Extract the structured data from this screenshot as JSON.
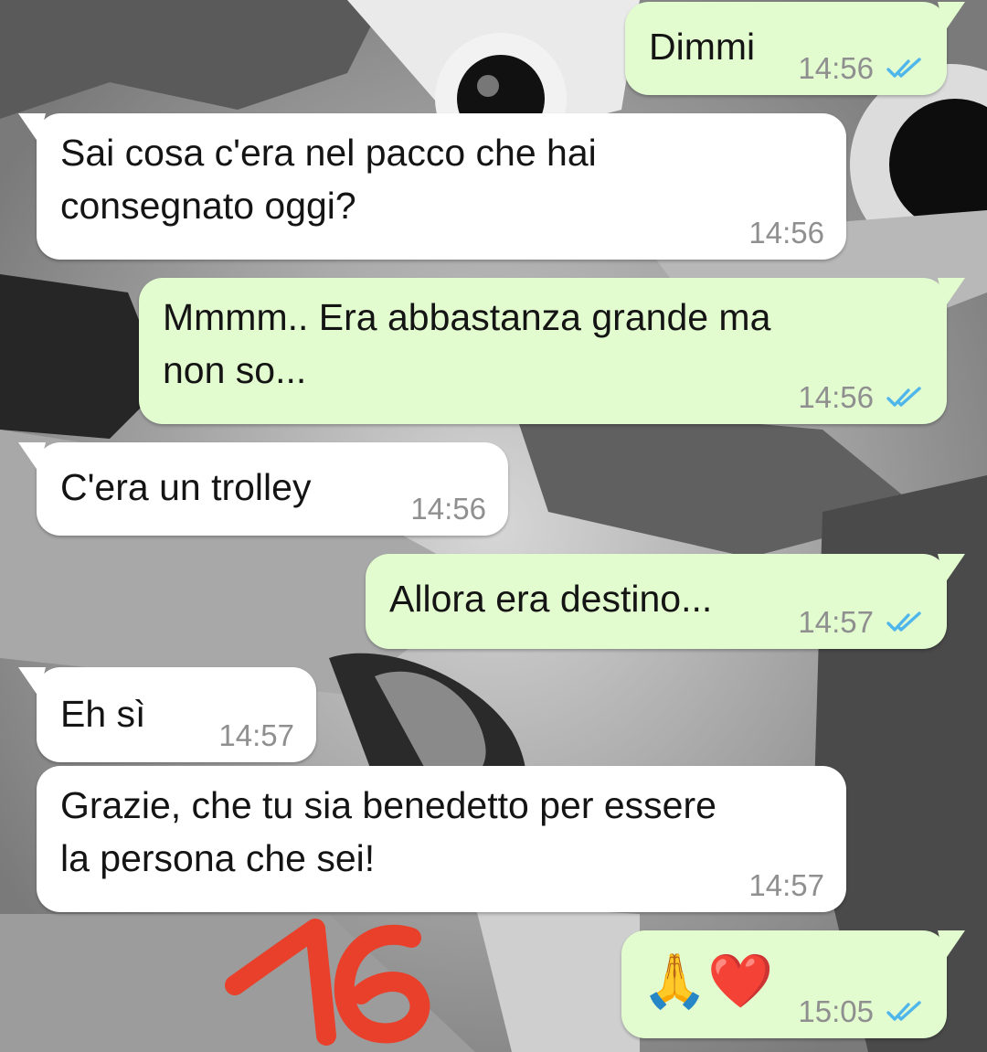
{
  "chat": {
    "messages": [
      {
        "direction": "out",
        "text": "Dimmi",
        "time": "14:56",
        "status_icon": "double-check-read-icon"
      },
      {
        "direction": "in",
        "text": "Sai cosa c'era nel pacco che hai\nconsegnato oggi?",
        "time": "14:56"
      },
      {
        "direction": "out",
        "text": "Mmmm.. Era abbastanza grande ma\nnon so...",
        "time": "14:56",
        "status_icon": "double-check-read-icon"
      },
      {
        "direction": "in",
        "text": "C'era un trolley",
        "time": "14:56"
      },
      {
        "direction": "out",
        "text": "Allora era destino...",
        "time": "14:57",
        "status_icon": "double-check-read-icon"
      },
      {
        "direction": "in",
        "text": "Eh sì",
        "time": "14:57"
      },
      {
        "direction": "in",
        "text": "Grazie, che tu sia benedetto per essere\nla persona che sei!",
        "time": "14:57"
      },
      {
        "direction": "out",
        "text": "🙏❤️",
        "time": "15:05",
        "status_icon": "double-check-read-icon"
      }
    ]
  },
  "annotation": {
    "text": "16",
    "color": "#e8402a"
  },
  "colors": {
    "incoming_bubble": "#ffffff",
    "outgoing_bubble": "#e2fbcf",
    "read_ticks": "#4fb6ec",
    "timestamp": "#8f8f8f"
  }
}
